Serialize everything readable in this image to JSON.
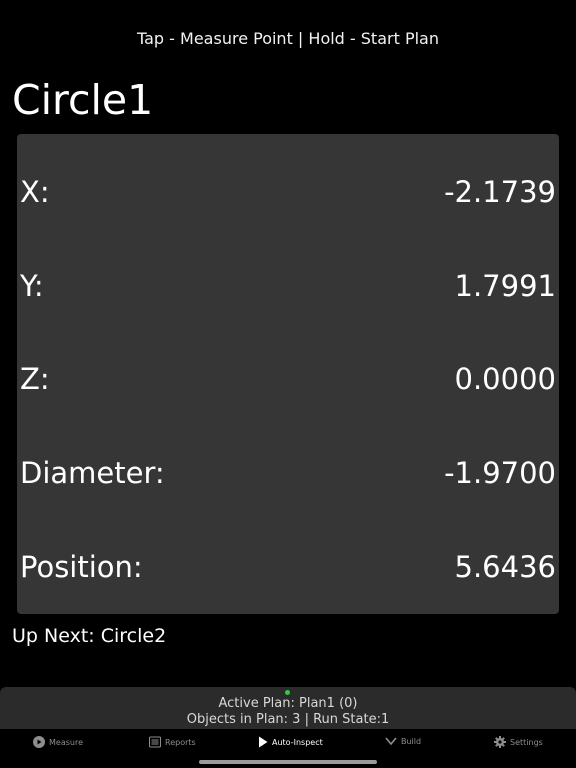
{
  "hint_text": "Tap - Measure Point | Hold - Start Plan",
  "feature_title": "Circle1",
  "measurements": [
    {
      "label": "X:",
      "value": "-2.1739"
    },
    {
      "label": "Y:",
      "value": "1.7991"
    },
    {
      "label": "Z:",
      "value": "0.0000"
    },
    {
      "label": "Diameter:",
      "value": "-1.9700"
    },
    {
      "label": "Position:",
      "value": "5.6436"
    }
  ],
  "up_next": "Up Next: Circle2",
  "status": {
    "active_plan": "Active Plan: Plan1 (0)",
    "objects_run_state": "Objects in Plan: 3 | Run State:1",
    "indicator_color": "#2ecc40"
  },
  "tabs": [
    {
      "label": "Measure",
      "icon": "play-circle-icon",
      "active": false
    },
    {
      "label": "Reports",
      "icon": "document-icon",
      "active": false
    },
    {
      "label": "Auto-Inspect",
      "icon": "play-icon",
      "active": true
    },
    {
      "label": "Build",
      "icon": "chevron-down-icon",
      "active": false
    },
    {
      "label": "Settings",
      "icon": "gear-icon",
      "active": false
    }
  ]
}
